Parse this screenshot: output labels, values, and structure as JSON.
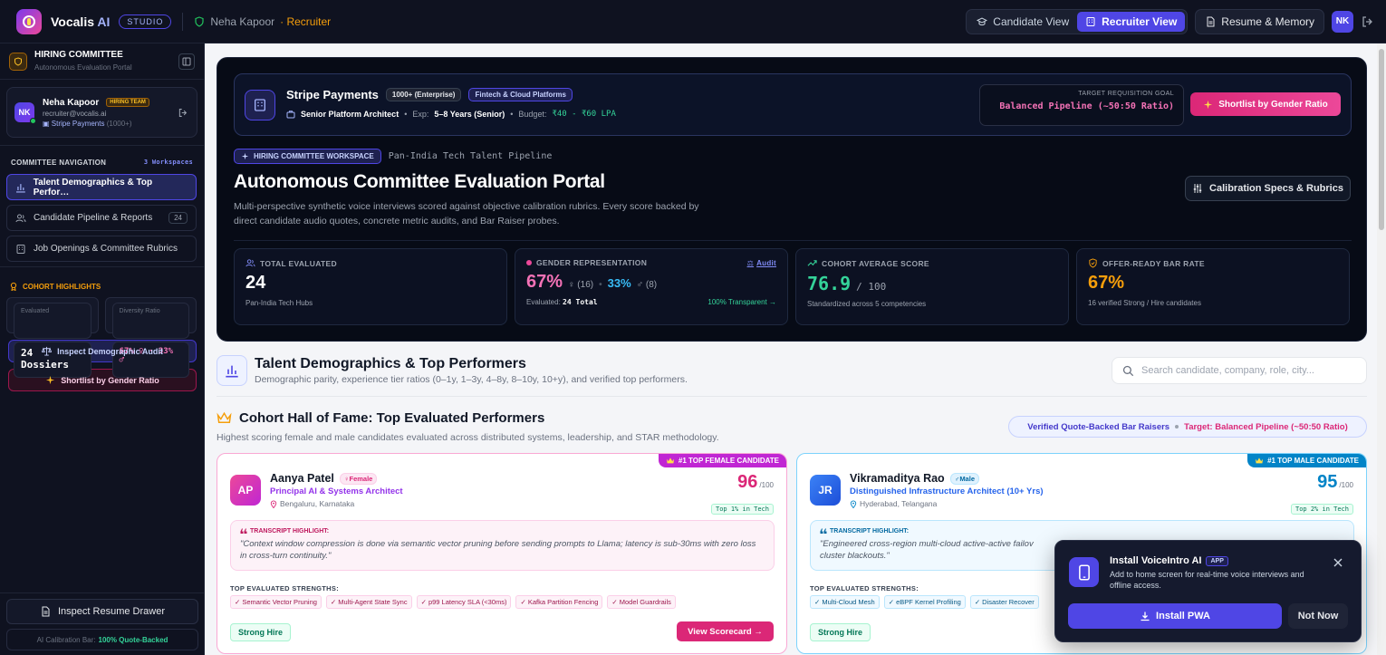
{
  "topbar": {
    "brand": "Vocalis",
    "brand_ai": "AI",
    "studio": "STUDIO",
    "recruiter_name": "Neha Kapoor",
    "recruiter_role": "· Recruiter",
    "candidate_view": "Candidate View",
    "recruiter_view": "Recruiter View",
    "resume_memory": "Resume & Memory",
    "avatar": "NK"
  },
  "sidebar": {
    "title": "HIRING COMMITTEE",
    "subtitle": "Autonomous Evaluation Portal",
    "user": {
      "initials": "NK",
      "name": "Neha Kapoor",
      "tag": "HIRING TEAM",
      "email": "recruiter@vocalis.ai",
      "company": "Stripe Payments",
      "company_size": "(1000+)"
    },
    "nav_header": "COMMITTEE NAVIGATION",
    "nav_count": "3 Workspaces",
    "nav": [
      {
        "label": "Talent Demographics & Top Perfor…",
        "active": true
      },
      {
        "label": "Candidate Pipeline & Reports",
        "count": "24"
      },
      {
        "label": "Job Openings & Committee Rubrics"
      }
    ],
    "highlights_header": "COHORT HIGHLIGHTS",
    "evaluated_label": "Evaluated",
    "evaluated_value": "24 Dossiers",
    "diversity_label": "Diversity Ratio",
    "diversity_value": "67% ♀ · 33% ♂",
    "audit_button": "Inspect Demographic Audit",
    "shortlist_button": "Shortlist by Gender Ratio",
    "drawer_button": "Inspect Resume Drawer",
    "calib_label": "AI Calibration Bar:",
    "calib_value": "100% Quote-Backed"
  },
  "hero": {
    "company": "Stripe Payments",
    "size_pill": "1000+ (Enterprise)",
    "industry_pill": "Fintech & Cloud Platforms",
    "role": "Senior Platform Architect",
    "exp_label": "Exp:",
    "exp_value": "5–8 Years (Senior)",
    "budget_label": "Budget:",
    "budget_value": "₹40 - ₹60 LPA",
    "goal_label": "TARGET REQUISITION GOAL",
    "goal_value": "Balanced Pipeline (~50:50 Ratio)",
    "shortlist_button": "Shortlist by Gender Ratio",
    "workspace_tag": "HIRING COMMITTEE WORKSPACE",
    "workspace_sub": "Pan-India Tech Talent Pipeline",
    "title": "Autonomous Committee Evaluation Portal",
    "description": "Multi-perspective synthetic voice interviews scored against objective calibration rubrics. Every score backed by direct candidate audio quotes, concrete metric audits, and Bar Raiser probes.",
    "spec_button": "Calibration Specs & Rubrics",
    "stats": {
      "total_label": "TOTAL EVALUATED",
      "total_value": "24",
      "total_sub": "Pan-India Tech Hubs",
      "gender_label": "GENDER REPRESENTATION",
      "gender_audit": "Audit",
      "female_pct": "67%",
      "female_count": "♀ (16)",
      "male_pct": "33%",
      "male_count": "♂ (8)",
      "gender_eval_label": "Evaluated:",
      "gender_eval_value": "24 Total",
      "gender_transparent": "100% Transparent →",
      "avg_label": "COHORT AVERAGE SCORE",
      "avg_value": "76.9",
      "avg_max": "/ 100",
      "avg_sub": "Standardized across 5 competencies",
      "offer_label": "OFFER-READY BAR RATE",
      "offer_value": "67%",
      "offer_sub": "16 verified Strong / Hire candidates"
    }
  },
  "section": {
    "title": "Talent Demographics & Top Performers",
    "subtitle": "Demographic parity, experience tier ratios (0–1y, 1–3y, 4–8y, 8–10y, 10+y), and verified top performers.",
    "search_placeholder": "Search candidate, company, role, city..."
  },
  "hof": {
    "title": "Cohort Hall of Fame: Top Evaluated Performers",
    "subtitle": "Highest scoring female and male candidates evaluated across distributed systems, leadership, and STAR methodology.",
    "verified": "Verified Quote-Backed Bar Raisers",
    "target": "Target: Balanced Pipeline (~50:50 Ratio)"
  },
  "cards": [
    {
      "ribbon": "#1 TOP FEMALE CANDIDATE",
      "initials": "AP",
      "name": "Aanya Patel",
      "gender": "♀Female",
      "role": "Principal AI & Systems Architect",
      "location": "Bengaluru, Karnataka",
      "score": "96",
      "score_max": "/100",
      "percentile": "Top 1% in Tech",
      "quote_label": "TRANSCRIPT HIGHLIGHT:",
      "quote": "\"Context window compression is done via semantic vector pruning before sending prompts to Llama; latency is sub-30ms with zero loss in cross-turn continuity.\"",
      "strengths_label": "TOP EVALUATED STRENGTHS:",
      "strengths": [
        "✓ Semantic Vector Pruning",
        "✓ Multi-Agent State Sync",
        "✓ p99 Latency SLA (<30ms)",
        "✓ Kafka Partition Fencing",
        "✓ Model Guardrails"
      ],
      "verdict": "Strong Hire",
      "action": "View Scorecard →"
    },
    {
      "ribbon": "#1 TOP MALE CANDIDATE",
      "initials": "JR",
      "name": "Vikramaditya Rao",
      "gender": "♂Male",
      "role": "Distinguished Infrastructure Architect (10+ Yrs)",
      "location": "Hyderabad, Telangana",
      "score": "95",
      "score_max": "/100",
      "percentile": "Top 2% in Tech",
      "quote_label": "TRANSCRIPT HIGHLIGHT:",
      "quote": "\"Engineered cross-region multi-cloud active-active failov",
      "quote_2": "cluster blackouts.\"",
      "strengths_label": "TOP EVALUATED STRENGTHS:",
      "strengths": [
        "✓ Multi-Cloud Mesh",
        "✓ eBPF Kernel Profiling",
        "✓ Disaster Recover"
      ],
      "verdict": "Strong Hire"
    }
  ],
  "toast": {
    "title": "Install VoiceIntro AI",
    "badge": "APP",
    "desc": "Add to home screen for real-time voice interviews and offline access.",
    "install": "Install PWA",
    "dismiss": "Not Now"
  }
}
